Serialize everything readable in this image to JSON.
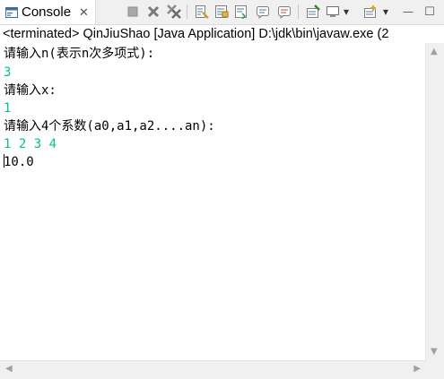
{
  "tab": {
    "label": "Console",
    "close": "✕"
  },
  "toolbar": {
    "buttons": [
      "terminate-icon",
      "remove-launch-icon",
      "remove-all-terminated-icon",
      "clear-console-icon",
      "scroll-lock-icon",
      "word-wrap-icon",
      "show-stdout-icon",
      "show-stderr-icon",
      "pin-console-icon",
      "display-selected-console-icon",
      "open-console-icon",
      "view-menu-icon",
      "minimize-icon",
      "maximize-icon"
    ],
    "minimize_glyph": "—",
    "maximize_glyph": "☐",
    "dropdown_glyph": "▾"
  },
  "status": {
    "text": "<terminated> QinJiuShao [Java Application] D:\\jdk\\bin\\javaw.exe  (2"
  },
  "console": {
    "lines": [
      {
        "text": "请输入n(表示n次多项式):",
        "kind": "prompt"
      },
      {
        "text": "3",
        "kind": "input"
      },
      {
        "text": "请输入x:",
        "kind": "prompt"
      },
      {
        "text": "1",
        "kind": "input"
      },
      {
        "text": "请输入4个系数(a0,a1,a2....an):",
        "kind": "prompt"
      },
      {
        "text": "1 2 3 4",
        "kind": "input"
      },
      {
        "text": "10.0",
        "kind": "prompt"
      }
    ]
  },
  "colors": {
    "prompt": "#000000",
    "input": "#00c87d",
    "background": "#ffffff",
    "chrome": "#f0f0f0"
  }
}
